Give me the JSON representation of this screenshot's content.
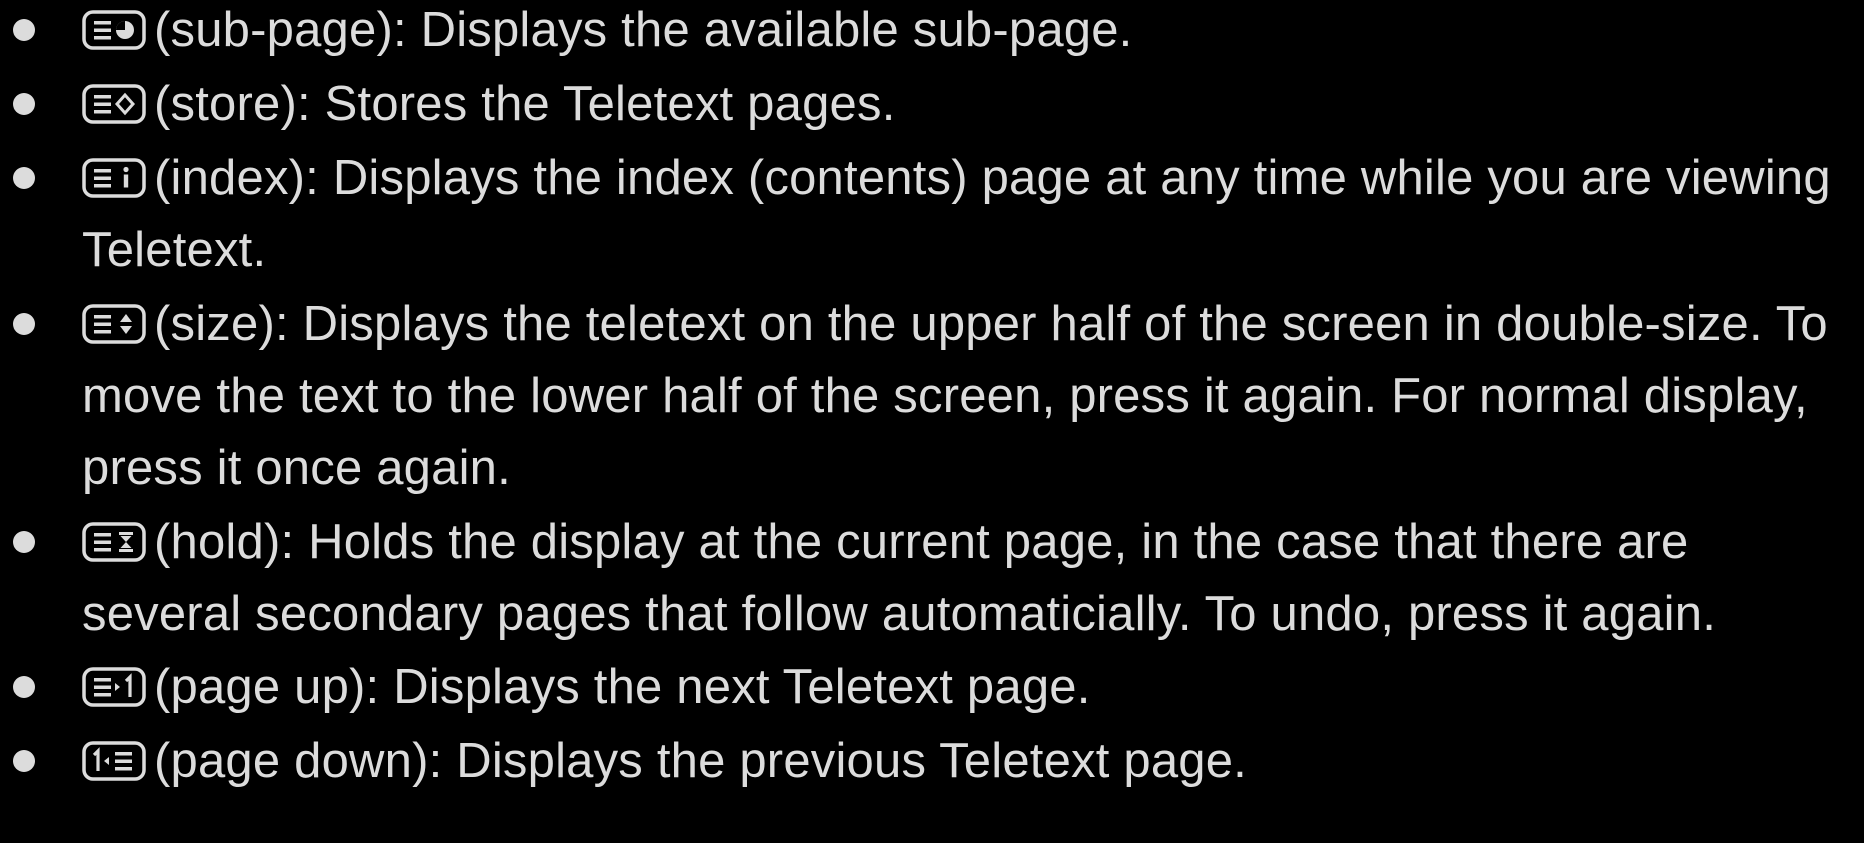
{
  "colors": {
    "background": "#000000",
    "text": "#dcdcdc"
  },
  "items": [
    {
      "icon": "teletext-subpage-icon",
      "label": "(sub-page):",
      "desc": "Displays the available sub-page."
    },
    {
      "icon": "teletext-store-icon",
      "label": "(store):",
      "desc": "Stores the Teletext pages."
    },
    {
      "icon": "teletext-index-icon",
      "label": "(index):",
      "desc": "Displays the index (contents) page at any time while you are viewing Teletext."
    },
    {
      "icon": "teletext-size-icon",
      "label": "(size):",
      "desc": "Displays the teletext on the upper half of the screen in double-size. To move the text to the lower half of the screen, press it again. For normal display, press it once again."
    },
    {
      "icon": "teletext-hold-icon",
      "label": "(hold):",
      "desc": "Holds the display at the current page, in the case that there are several secondary pages that follow automaticially. To undo, press it again."
    },
    {
      "icon": "teletext-page-up-icon",
      "label": "(page up):",
      "desc": "Displays the next Teletext page."
    },
    {
      "icon": "teletext-page-down-icon",
      "label": "(page down):",
      "desc": "Displays the previous Teletext page."
    }
  ]
}
